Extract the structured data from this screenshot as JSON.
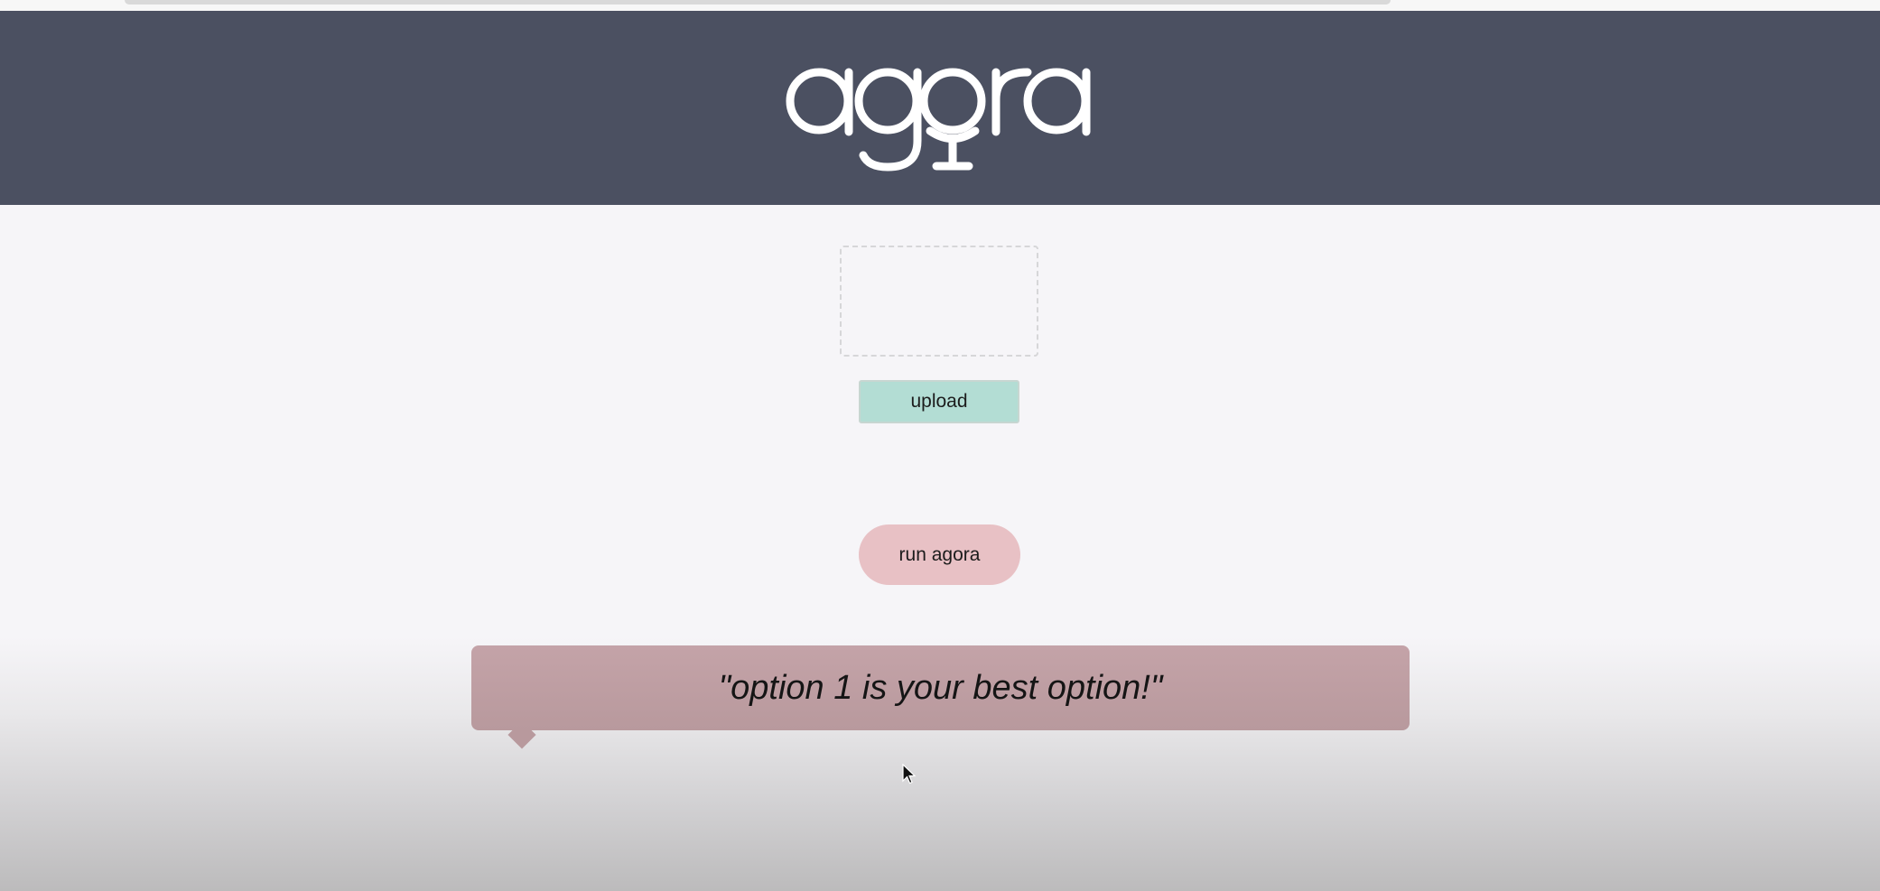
{
  "app": {
    "logo_text": "agora"
  },
  "upload": {
    "button_label": "upload"
  },
  "run": {
    "button_label": "run agora"
  },
  "result": {
    "message": "\"option 1 is your best option!\""
  },
  "colors": {
    "header_bg": "#4b5061",
    "page_bg": "#f6f5f8",
    "upload_button_bg": "#b3ddd4",
    "run_button_bg": "#e8c1c5",
    "result_bubble_bg": "#c4a3a8"
  },
  "icons": {
    "logo": "agora-microphone-logo",
    "cursor": "mouse-pointer-icon"
  }
}
